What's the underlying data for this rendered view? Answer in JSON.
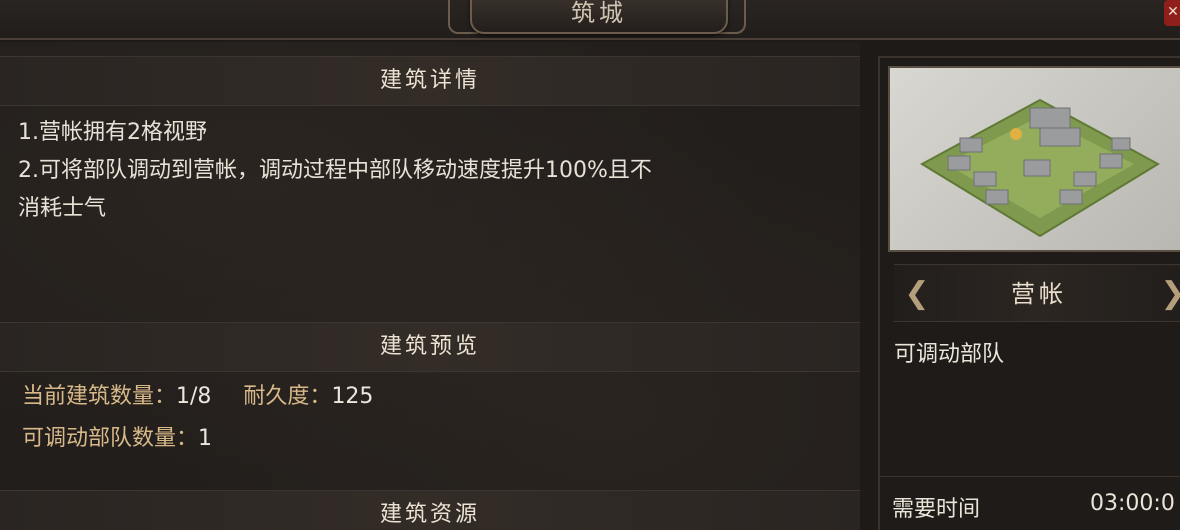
{
  "window": {
    "title": "筑城",
    "close_label": "✕"
  },
  "details": {
    "header": "建筑详情",
    "lines": [
      "1.营帐拥有2格视野",
      "2.可将部队调动到营帐，调动过程中部队移动速度提升100%且不",
      "消耗士气"
    ]
  },
  "preview": {
    "header": "建筑预览",
    "count_label": "当前建筑数量：",
    "count_value": "1/8",
    "durability_label": "耐久度：",
    "durability_value": "125",
    "troops_label": "可调动部队数量：",
    "troops_value": "1"
  },
  "resources": {
    "header": "建筑资源"
  },
  "side": {
    "image_icon": "camp-image",
    "prev_arrow": "❮",
    "next_arrow": "❯",
    "building_name": "营帐",
    "description": "可调动部队",
    "time_label": "需要时间",
    "time_value": "03:00:0"
  }
}
